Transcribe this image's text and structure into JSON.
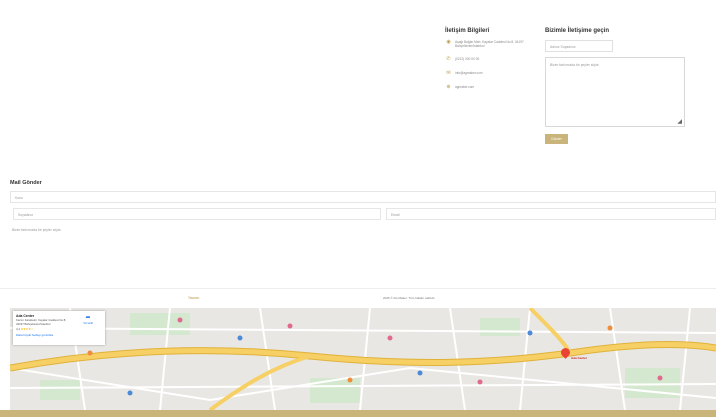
{
  "contact_info": {
    "title": "İletişim Bilgileri",
    "items": [
      {
        "icon": "location-pin-icon",
        "text": "Aşağı Bağlar Mah. Kayalar Caddesi No:8, 34197 Bahçelievler/İstanbul"
      },
      {
        "icon": "phone-icon",
        "text": "(0212) 000 00 00"
      },
      {
        "icon": "email-icon",
        "text": "info@agmaker.com"
      },
      {
        "icon": "globe-icon",
        "text": "agmaker.com"
      }
    ]
  },
  "contact_form": {
    "title": "Bizimle İletişime geçin",
    "name_placeholder": "Adınız Soyadınız",
    "message_placeholder": "Bizim farkımızda bir şeyler söyle.",
    "send_label": "Gönder"
  },
  "mail_section": {
    "title": "Mail Gönder",
    "subject_placeholder": "Konu",
    "name_placeholder": "Soyadınız",
    "email_placeholder": "Email",
    "message_placeholder": "Bizim farkımızda bir şeyler söyle."
  },
  "footer": {
    "link": "Tasarım",
    "copyright": "2025 © AG Maker. Tüm hakları saklıdır."
  },
  "map": {
    "card_title": "Ada Center",
    "card_address": "Kazım Karabekir, Kayalar Caddesi No:8, 34197 Bahçelievler/İstanbul",
    "card_rating": "4,4",
    "card_stars": "★★★★☆",
    "card_link": "Daha büyük haritayı görüntüle",
    "directions_label": "Yol tarifi",
    "pin_label": "Ada Center"
  },
  "colors": {
    "accent": "#c9b57a",
    "link_gold": "#b89a4a",
    "map_pin": "#ea4335",
    "map_highway": "#f6cf65"
  }
}
